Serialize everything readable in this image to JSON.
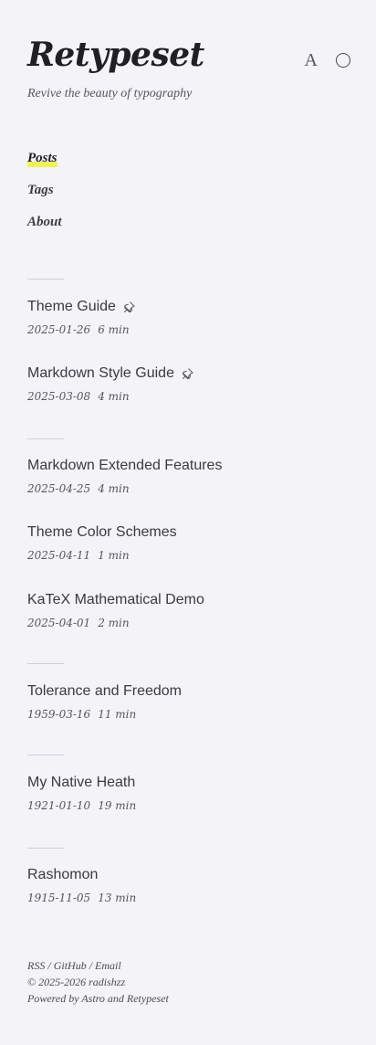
{
  "header": {
    "site_title": "Retypeset",
    "description": "Revive the beauty of typography",
    "lang_label": "A"
  },
  "nav": {
    "items": [
      {
        "label": "Posts",
        "active": true
      },
      {
        "label": "Tags"
      },
      {
        "label": "About"
      }
    ]
  },
  "posts": [
    {
      "title": "Theme Guide",
      "date": "2025-01-26",
      "read": "6 min",
      "pinned": true
    },
    {
      "title": "Markdown Style Guide",
      "date": "2025-03-08",
      "read": "4 min",
      "pinned": true
    },
    {
      "title": "Markdown Extended Features",
      "date": "2025-04-25",
      "read": "4 min"
    },
    {
      "title": "Theme Color Schemes",
      "date": "2025-04-11",
      "read": "1 min"
    },
    {
      "title": "KaTeX Mathematical Demo",
      "date": "2025-04-01",
      "read": "2 min"
    },
    {
      "title": "Tolerance and Freedom",
      "date": "1959-03-16",
      "read": "11 min"
    },
    {
      "title": "My Native Heath",
      "date": "1921-01-10",
      "read": "19 min"
    },
    {
      "title": "Rashomon",
      "date": "1915-11-05",
      "read": "13 min"
    }
  ],
  "footer": {
    "rss": "RSS",
    "github": "GitHub",
    "email": "Email",
    "sep": "/",
    "copyright": "© 2025-2026 radishzz",
    "powered": "Powered by Astro and Retypeset"
  },
  "colors": {
    "background": "#f4f3f8",
    "highlight": "#eef25a",
    "text": "#3a3a40"
  }
}
